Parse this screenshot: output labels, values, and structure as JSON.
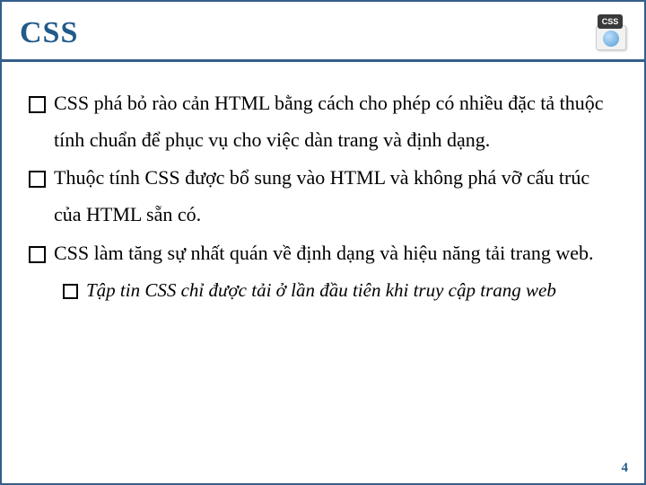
{
  "title": "CSS",
  "icon_badge": "CSS",
  "bullets": [
    "CSS phá bỏ rào cản HTML bằng cách cho phép có nhiều đặc tả thuộc tính chuẩn để phục vụ cho việc dàn trang và định dạng.",
    "Thuộc tính CSS được bổ sung vào HTML và không phá vỡ cấu trúc của HTML sẵn có.",
    "CSS làm tăng sự nhất quán về định dạng và hiệu năng tải trang web."
  ],
  "sub_bullets": [
    "Tập tin CSS chỉ được tải ở lần đầu tiên khi truy cập trang web"
  ],
  "page_number": "4"
}
